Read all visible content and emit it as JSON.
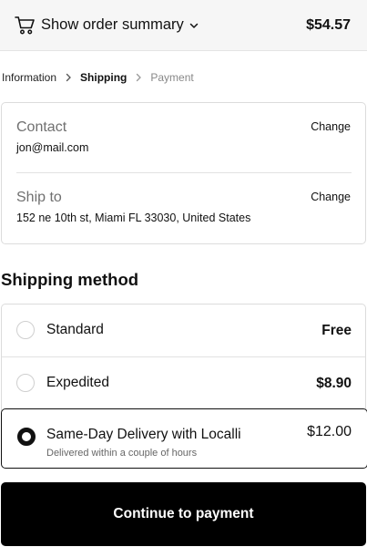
{
  "header": {
    "cart_icon": "shopping-cart-icon",
    "summary_label": "Show order summary",
    "chevron_icon": "chevron-down-icon",
    "total": "$54.57"
  },
  "breadcrumb": {
    "items": [
      "Information",
      "Shipping",
      "Payment"
    ],
    "separator_icon": "chevron-right-icon",
    "active_index": 1
  },
  "review": {
    "contact": {
      "title": "Contact",
      "value": "jon@mail.com",
      "change_label": "Change"
    },
    "ship_to": {
      "title": "Ship to",
      "value": "152 ne 10th st, Miami FL 33030, United States",
      "change_label": "Change"
    }
  },
  "shipping": {
    "heading": "Shipping method",
    "methods": [
      {
        "name": "Standard",
        "price": "Free",
        "note": "",
        "selected": false
      },
      {
        "name": "Expedited",
        "price": "$8.90",
        "note": "",
        "selected": false
      },
      {
        "name": "Same-Day Delivery with Localli",
        "price": "$12.00",
        "note": "Delivered within a couple of hours",
        "selected": true
      }
    ]
  },
  "actions": {
    "continue_label": "Continue to payment"
  },
  "colors": {
    "primary": "#000000",
    "background": "#ffffff",
    "summary_bg": "#f6f6f6",
    "border": "#dcdcdc",
    "muted": "#707070"
  }
}
